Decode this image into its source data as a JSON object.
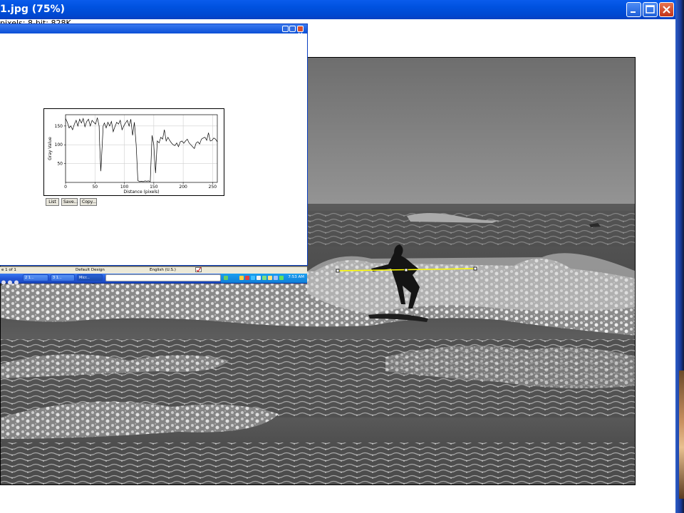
{
  "main_window": {
    "title": "1.jpg (75%)",
    "info": "pixels; 8-bit; 828K"
  },
  "plot_window": {
    "chart_data": {
      "type": "line",
      "xlabel": "Distance (pixels)",
      "ylabel": "Gray Value",
      "xlim": [
        0,
        258
      ],
      "ylim": [
        0,
        180
      ],
      "x_ticks": [
        "0",
        "50",
        "100",
        "150",
        "200",
        "250"
      ],
      "y_ticks": [
        "50",
        "100",
        "150"
      ],
      "grid": true,
      "series": [
        {
          "x": [
            0,
            3,
            6,
            9,
            12,
            15,
            18,
            21,
            24,
            27,
            30,
            33,
            36,
            39,
            42,
            45,
            48,
            51,
            54,
            57,
            58,
            60,
            62,
            64,
            66,
            69,
            72,
            75,
            78,
            81,
            84,
            87,
            90,
            93,
            96,
            99,
            102,
            105,
            108,
            111,
            114,
            117,
            120,
            123,
            126,
            129,
            132,
            135,
            138,
            141,
            144,
            147,
            150,
            153,
            156,
            159,
            162,
            165,
            168,
            171,
            174,
            177,
            180,
            183,
            186,
            189,
            192,
            195,
            198,
            201,
            204,
            207,
            210,
            213,
            216,
            219,
            222,
            225,
            228,
            231,
            234,
            237,
            240,
            243,
            246,
            249,
            252,
            255,
            258
          ],
          "y": [
            170,
            160,
            145,
            150,
            140,
            155,
            165,
            150,
            168,
            158,
            170,
            148,
            162,
            168,
            150,
            165,
            160,
            155,
            172,
            150,
            100,
            30,
            90,
            150,
            158,
            145,
            160,
            150,
            162,
            135,
            148,
            160,
            155,
            165,
            140,
            150,
            158,
            165,
            150,
            168,
            125,
            160,
            100,
            5,
            2,
            3,
            2,
            4,
            3,
            4,
            2,
            125,
            100,
            25,
            110,
            105,
            120,
            115,
            140,
            110,
            120,
            112,
            105,
            100,
            98,
            105,
            95,
            108,
            110,
            104,
            110,
            115,
            105,
            100,
            95,
            90,
            105,
            108,
            102,
            115,
            118,
            120,
            112,
            132,
            110,
            112,
            118,
            115,
            108
          ]
        }
      ]
    },
    "buttons": [
      "List",
      "Save...",
      "Copy..."
    ]
  },
  "embedded_status": {
    "page": "e 1 of 1",
    "design": "Default Design",
    "language": "English (U.S.)"
  },
  "embedded_taskbar": {
    "items": [
      "2 1...",
      "3 1...",
      "Micr..."
    ],
    "clock": "7:53 AM"
  },
  "colors": {
    "title_bar": "#0052e0",
    "line_selection": "#ffff00"
  }
}
